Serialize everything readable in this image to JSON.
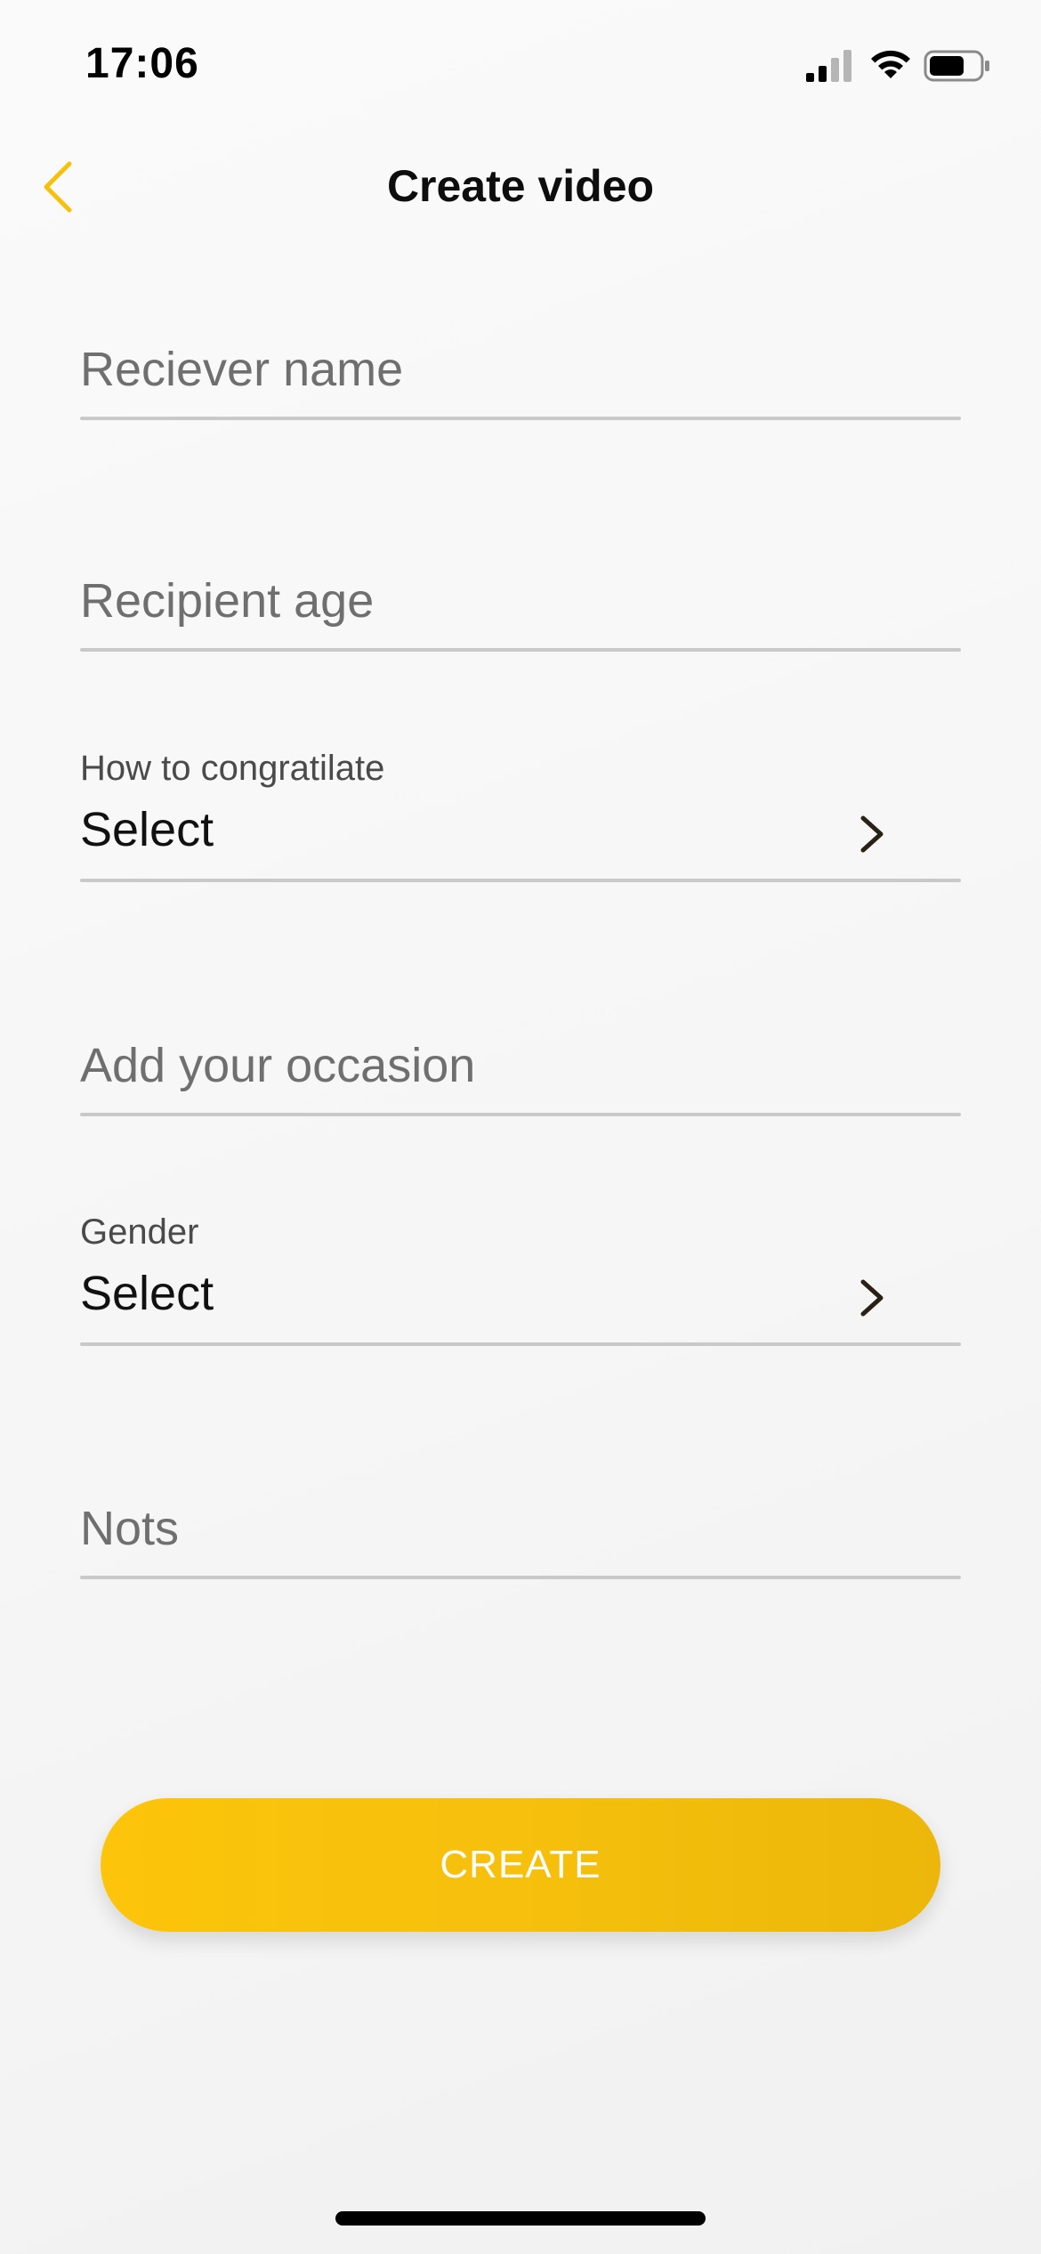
{
  "status_bar": {
    "time": "17:06",
    "icons": [
      "cellular-signal-icon",
      "wifi-icon",
      "battery-icon"
    ]
  },
  "header": {
    "title": "Create video",
    "back_icon": "chevron-left-icon"
  },
  "form": {
    "receiver_name": {
      "placeholder": "Reciever name",
      "value": ""
    },
    "recipient_age": {
      "placeholder": "Recipient age",
      "value": ""
    },
    "congratulate": {
      "label": "How to congratilate",
      "value": "Select",
      "icon": "chevron-right-icon"
    },
    "occasion": {
      "placeholder": "Add your occasion",
      "value": ""
    },
    "gender": {
      "label": "Gender",
      "value": "Select",
      "icon": "chevron-right-icon"
    },
    "notes": {
      "placeholder": "Nots",
      "value": ""
    }
  },
  "create_button": {
    "label": "CREATE"
  },
  "colors": {
    "accent": "#f7c10b",
    "underline": "#c9c9c9",
    "placeholder": "#6f6f6f"
  }
}
